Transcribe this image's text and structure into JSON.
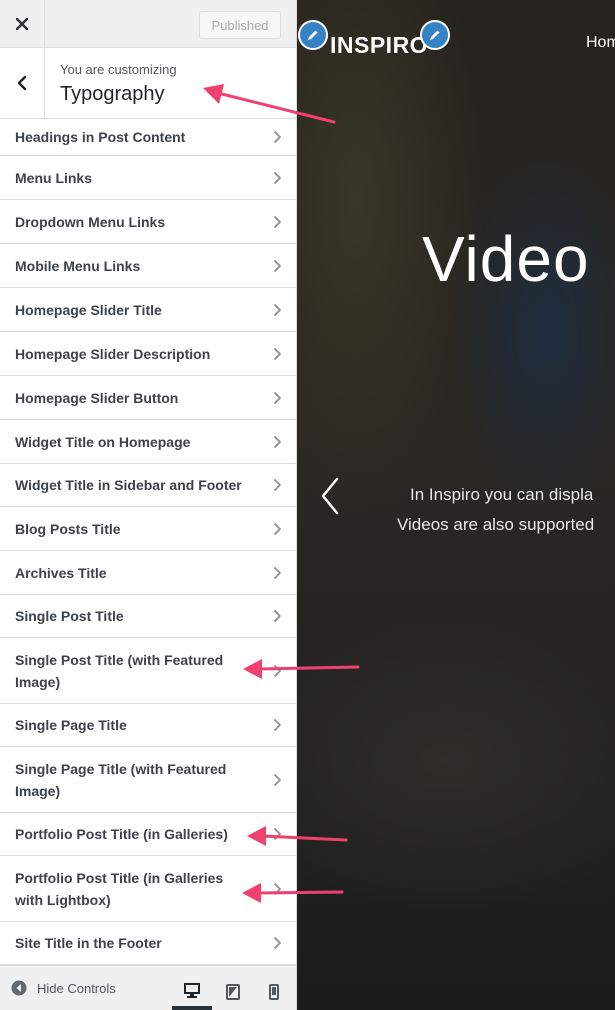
{
  "topbar": {
    "close_icon": "close-icon",
    "published_label": "Published"
  },
  "section_header": {
    "customizing_label": "You are customizing",
    "title": "Typography"
  },
  "items": [
    {
      "label": "Headings in Post Content"
    },
    {
      "label": "Menu Links"
    },
    {
      "label": "Dropdown Menu Links"
    },
    {
      "label": "Mobile Menu Links"
    },
    {
      "label": "Homepage Slider Title"
    },
    {
      "label": "Homepage Slider Description"
    },
    {
      "label": "Homepage Slider Button"
    },
    {
      "label": "Widget Title on Homepage"
    },
    {
      "label": "Widget Title in Sidebar and Footer"
    },
    {
      "label": "Blog Posts Title"
    },
    {
      "label": "Archives Title"
    },
    {
      "label": "Single Post Title"
    },
    {
      "label": "Single Post Title (with Featured Image)"
    },
    {
      "label": "Single Page Title"
    },
    {
      "label": "Single Page Title (with Featured Image)"
    },
    {
      "label": "Portfolio Post Title (in Galleries)"
    },
    {
      "label": "Portfolio Post Title (in Galleries with Lightbox)"
    },
    {
      "label": "Site Title in the Footer"
    }
  ],
  "footer": {
    "hide_controls_label": "Hide Controls",
    "devices": [
      "desktop-icon",
      "tablet-icon",
      "mobile-icon"
    ]
  },
  "preview": {
    "logo": "INSPIRO",
    "nav_home": "Hom",
    "hero_title": "Video",
    "hero_line1": "In Inspiro you can displa",
    "hero_line2": "Videos are also supported"
  },
  "colors": {
    "accent_blue": "#3582c4",
    "annotation_arrow": "#f0406e",
    "panel_bg": "#f0f0f1"
  }
}
